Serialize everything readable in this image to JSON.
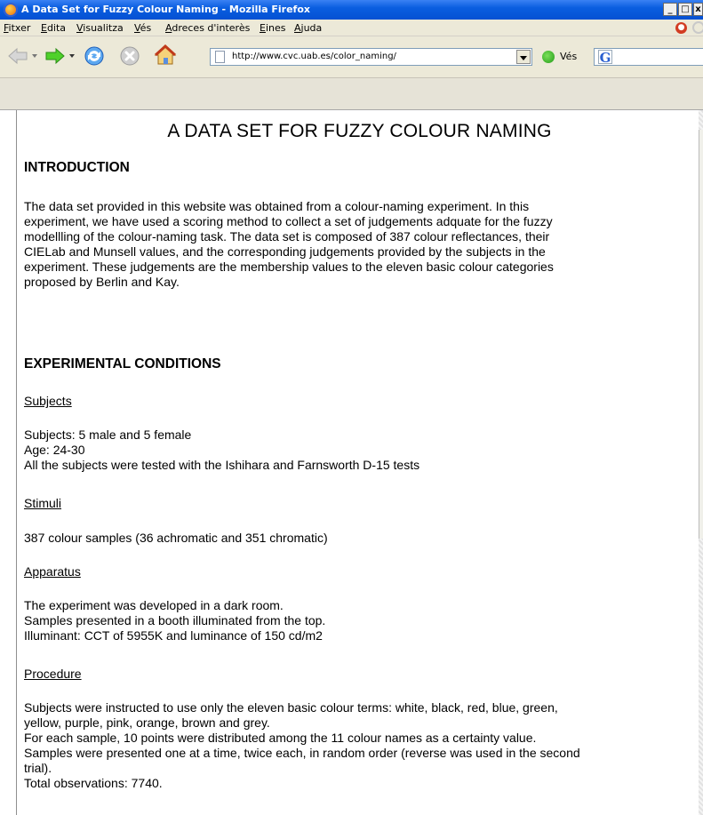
{
  "window": {
    "title": "A Data Set for Fuzzy Colour Naming - Mozilla Firefox",
    "min_glyph": "_",
    "max_glyph": "□",
    "close_glyph": "x"
  },
  "menu": {
    "items": [
      "Fitxer",
      "Edita",
      "Visualitza",
      "Vés",
      "Adreces d'interès",
      "Eines",
      "Ajuda"
    ]
  },
  "toolbar": {
    "url": "http://www.cvc.uab.es/color_naming/",
    "go_label": "Vés",
    "search_value": ""
  },
  "page": {
    "title": "A DATA SET FOR FUZZY COLOUR NAMING",
    "intro_heading": "INTRODUCTION",
    "intro_lines": [
      "The data set provided in this website was obtained from a colour-naming experiment. In this",
      "experiment, we have used a scoring method to collect a set of judgements adquate for the fuzzy",
      "modellling of the colour-naming task. The data set is composed of 387 colour reflectances, their",
      "CIELab and Munsell values, and the corresponding judgements provided by the subjects in the",
      "experiment. These judgements are the membership values to the eleven basic colour categories",
      "proposed by Berlin and Kay."
    ],
    "conditions_heading": "EXPERIMENTAL CONDITIONS",
    "subjects_link": "Subjects",
    "subjects_lines": [
      "Subjects: 5 male and 5 female",
      "Age: 24-30",
      "All the subjects were tested with the Ishihara and Farnsworth D-15 tests"
    ],
    "stimuli_link": "Stimuli",
    "stimuli_lines": [
      "387 colour samples (36 achromatic and 351 chromatic)"
    ],
    "apparatus_link": "Apparatus",
    "apparatus_lines": [
      "The experiment was developed in a dark room.",
      "Samples presented in a booth illuminated from the top.",
      "Illuminant: CCT of 5955K and luminance of 150 cd/m2"
    ],
    "procedure_link": "Procedure",
    "procedure_lines": [
      "Subjects were instructed to use only the eleven basic colour terms: white, black, red, blue, green,",
      "yellow, purple, pink, orange, brown and grey.",
      "For each sample, 10 points were distributed among the 11 colour names as a certainty value.",
      "Samples were presented one at a time, twice each, in random order (reverse was used in the second",
      "trial).",
      "Total observations: 7740."
    ]
  },
  "icons": {
    "app": "firefox-icon",
    "back": "back-arrow-icon",
    "forward": "forward-arrow-icon",
    "reload": "reload-icon",
    "stop": "stop-icon",
    "home": "home-icon",
    "page": "page-icon",
    "go": "go-icon",
    "search_engine": "google-icon"
  },
  "colors": {
    "titlebar": "#0a5ee0",
    "chrome": "#ece9d8",
    "forward_arrow": "#3fc51e",
    "back_arrow": "#b8b8b8"
  }
}
